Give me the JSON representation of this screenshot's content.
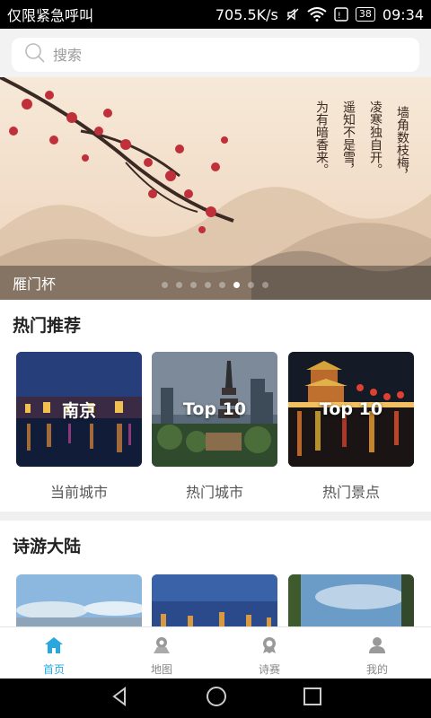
{
  "status_bar": {
    "carrier": "仅限紧急呼叫",
    "speed": "705.5K/s",
    "battery": "38",
    "time": "09:34"
  },
  "search": {
    "placeholder": "搜索"
  },
  "banner": {
    "title": "雁门杯",
    "dot_count": 8,
    "active_dot": 5
  },
  "hot": {
    "title": "热门推荐",
    "cards": [
      {
        "overlay": "南京",
        "label": "当前城市"
      },
      {
        "overlay": "Top 10",
        "label": "热门城市"
      },
      {
        "overlay": "Top 10",
        "label": "热门景点"
      }
    ]
  },
  "poetry": {
    "title": "诗游大陆"
  },
  "nav": {
    "items": [
      {
        "label": "首页",
        "icon": "home-icon"
      },
      {
        "label": "地图",
        "icon": "map-icon"
      },
      {
        "label": "诗赛",
        "icon": "medal-icon"
      },
      {
        "label": "我的",
        "icon": "user-icon"
      }
    ],
    "active_color": "#29a8e0"
  }
}
